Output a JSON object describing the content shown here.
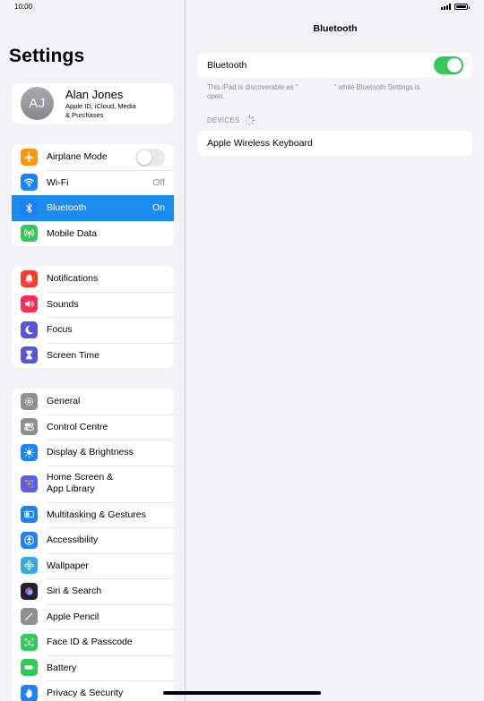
{
  "status_bar": {
    "time": "10:00"
  },
  "sidebar": {
    "title": "Settings",
    "profile": {
      "initials": "AJ",
      "name": "Alan Jones",
      "subtitle_line1": "Apple ID, iCloud, Media",
      "subtitle_line2": "& Purchases"
    },
    "group1": [
      {
        "label": "Airplane Mode",
        "icon": "airplane-icon",
        "color": "#ff9500"
      },
      {
        "label": "Wi-Fi",
        "value": "Off",
        "icon": "wifi-icon",
        "color": "#1a82fb"
      },
      {
        "label": "Bluetooth",
        "value": "On",
        "icon": "bluetooth-icon",
        "color": "#1a82fb"
      },
      {
        "label": "Mobile Data",
        "icon": "antenna-icon",
        "color": "#34c759"
      }
    ],
    "group2": [
      {
        "label": "Notifications",
        "icon": "bell-icon",
        "color": "#ff3b30"
      },
      {
        "label": "Sounds",
        "icon": "speaker-icon",
        "color": "#ff2d55"
      },
      {
        "label": "Focus",
        "icon": "moon-icon",
        "color": "#5856d6"
      },
      {
        "label": "Screen Time",
        "icon": "hourglass-icon",
        "color": "#5856d6"
      }
    ],
    "group3": [
      {
        "label": "General",
        "icon": "gear-icon",
        "color": "#8e8e93"
      },
      {
        "label": "Control Centre",
        "icon": "switches-icon",
        "color": "#8e8e93"
      },
      {
        "label": "Display & Brightness",
        "icon": "sun-icon",
        "color": "#1a82fb"
      },
      {
        "label_line1": "Home Screen &",
        "label_line2": "App Library",
        "icon": "app-grid-icon",
        "color": "#5e5ce6"
      },
      {
        "label": "Multitasking & Gestures",
        "icon": "multitasking-icon",
        "color": "#1a82fb"
      },
      {
        "label": "Accessibility",
        "icon": "accessibility-icon",
        "color": "#1a82fb"
      },
      {
        "label": "Wallpaper",
        "icon": "flower-icon",
        "color": "#35aadc"
      },
      {
        "label": "Siri & Search",
        "icon": "siri-icon",
        "color": "#222222"
      },
      {
        "label": "Apple Pencil",
        "icon": "pencil-icon",
        "color": "#8e8e93"
      },
      {
        "label": "Face ID & Passcode",
        "icon": "face-id-icon",
        "color": "#34c759"
      },
      {
        "label": "Battery",
        "icon": "battery-icon",
        "color": "#34c759"
      },
      {
        "label": "Privacy & Security",
        "icon": "hand-icon",
        "color": "#1a82fb"
      }
    ]
  },
  "detail": {
    "title": "Bluetooth",
    "toggle_label": "Bluetooth",
    "toggle_on": true,
    "footnote_part1": "This iPad is discoverable as \"",
    "footnote_part2": "\" while Bluetooth Settings is",
    "footnote_part3": "open.",
    "devices_header": "DEVICES",
    "devices": [
      "Apple Wireless Keyboard"
    ]
  },
  "colors": {
    "accent": "#1c8cf0",
    "toggle_on": "#34c759"
  }
}
